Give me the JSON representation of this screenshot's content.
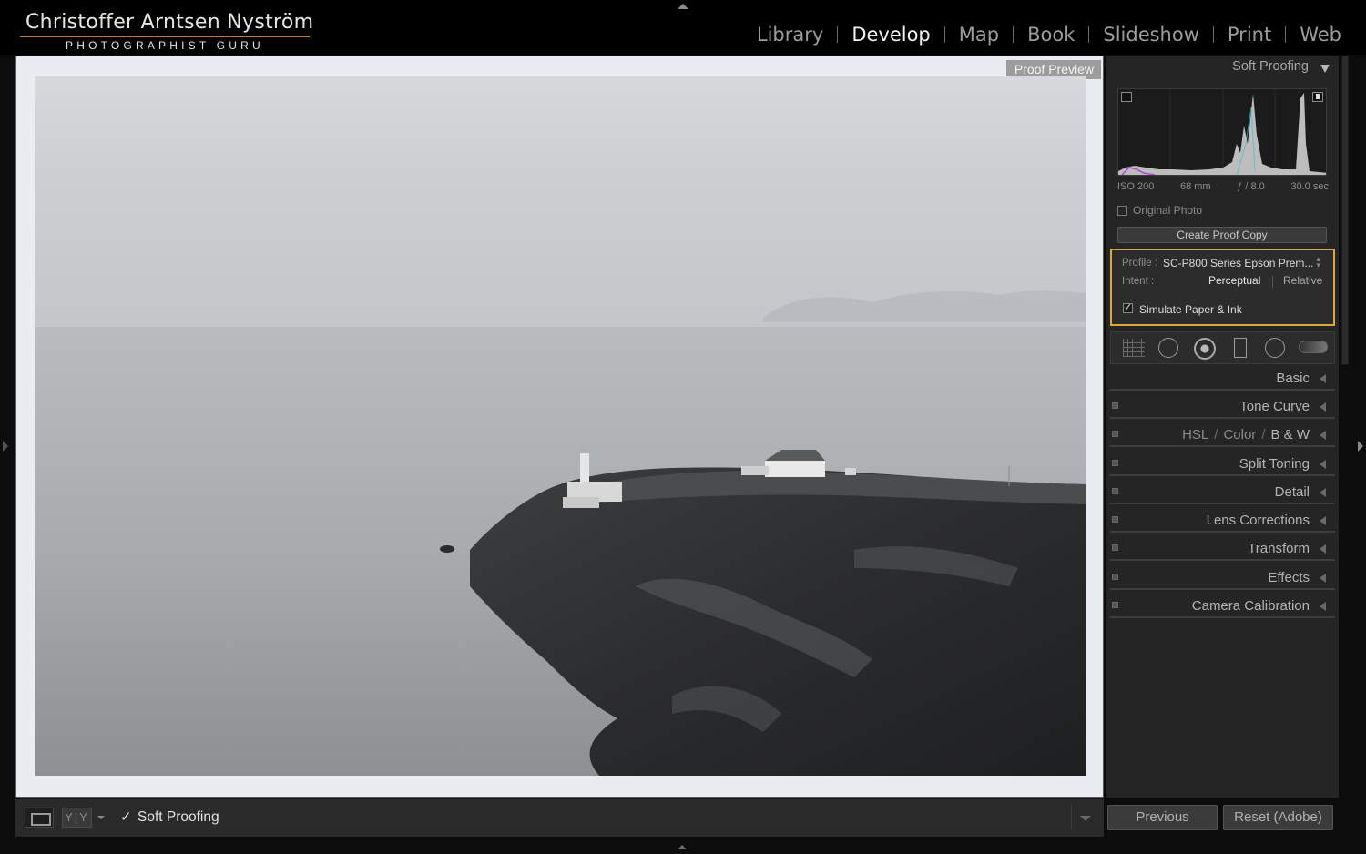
{
  "identity": {
    "name": "Christoffer Arntsen Nyström",
    "subtitle": "PHOTOGRAPHIST GURU"
  },
  "modules": [
    "Library",
    "Develop",
    "Map",
    "Book",
    "Slideshow",
    "Print",
    "Web"
  ],
  "active_module": "Develop",
  "preview": {
    "label": "Proof Preview"
  },
  "toolbar": {
    "soft_proofing_label": "Soft Proofing",
    "yy_label": "Y|Y"
  },
  "panel": {
    "title": "Soft Proofing",
    "exif": {
      "iso": "ISO 200",
      "focal": "68 mm",
      "aperture": "ƒ / 8.0",
      "shutter": "30.0 sec"
    },
    "original_photo_label": "Original Photo",
    "create_proof_copy_label": "Create Proof Copy",
    "profile_label": "Profile :",
    "profile_value": "SC-P800 Series Epson Prem...",
    "intent_label": "Intent :",
    "intent_perceptual": "Perceptual",
    "intent_relative": "Relative",
    "simulate_label": "Simulate Paper & Ink",
    "hsl": {
      "a": "HSL",
      "b": "Color",
      "c": "B & W"
    },
    "sections": [
      "Basic",
      "Tone Curve",
      "Split Toning",
      "Detail",
      "Lens Corrections",
      "Transform",
      "Effects",
      "Camera Calibration"
    ]
  },
  "buttons": {
    "previous": "Previous",
    "reset": "Reset (Adobe)"
  },
  "colors": {
    "highlight_border": "#e0a63c",
    "identity_accent": "#c47a2a"
  }
}
